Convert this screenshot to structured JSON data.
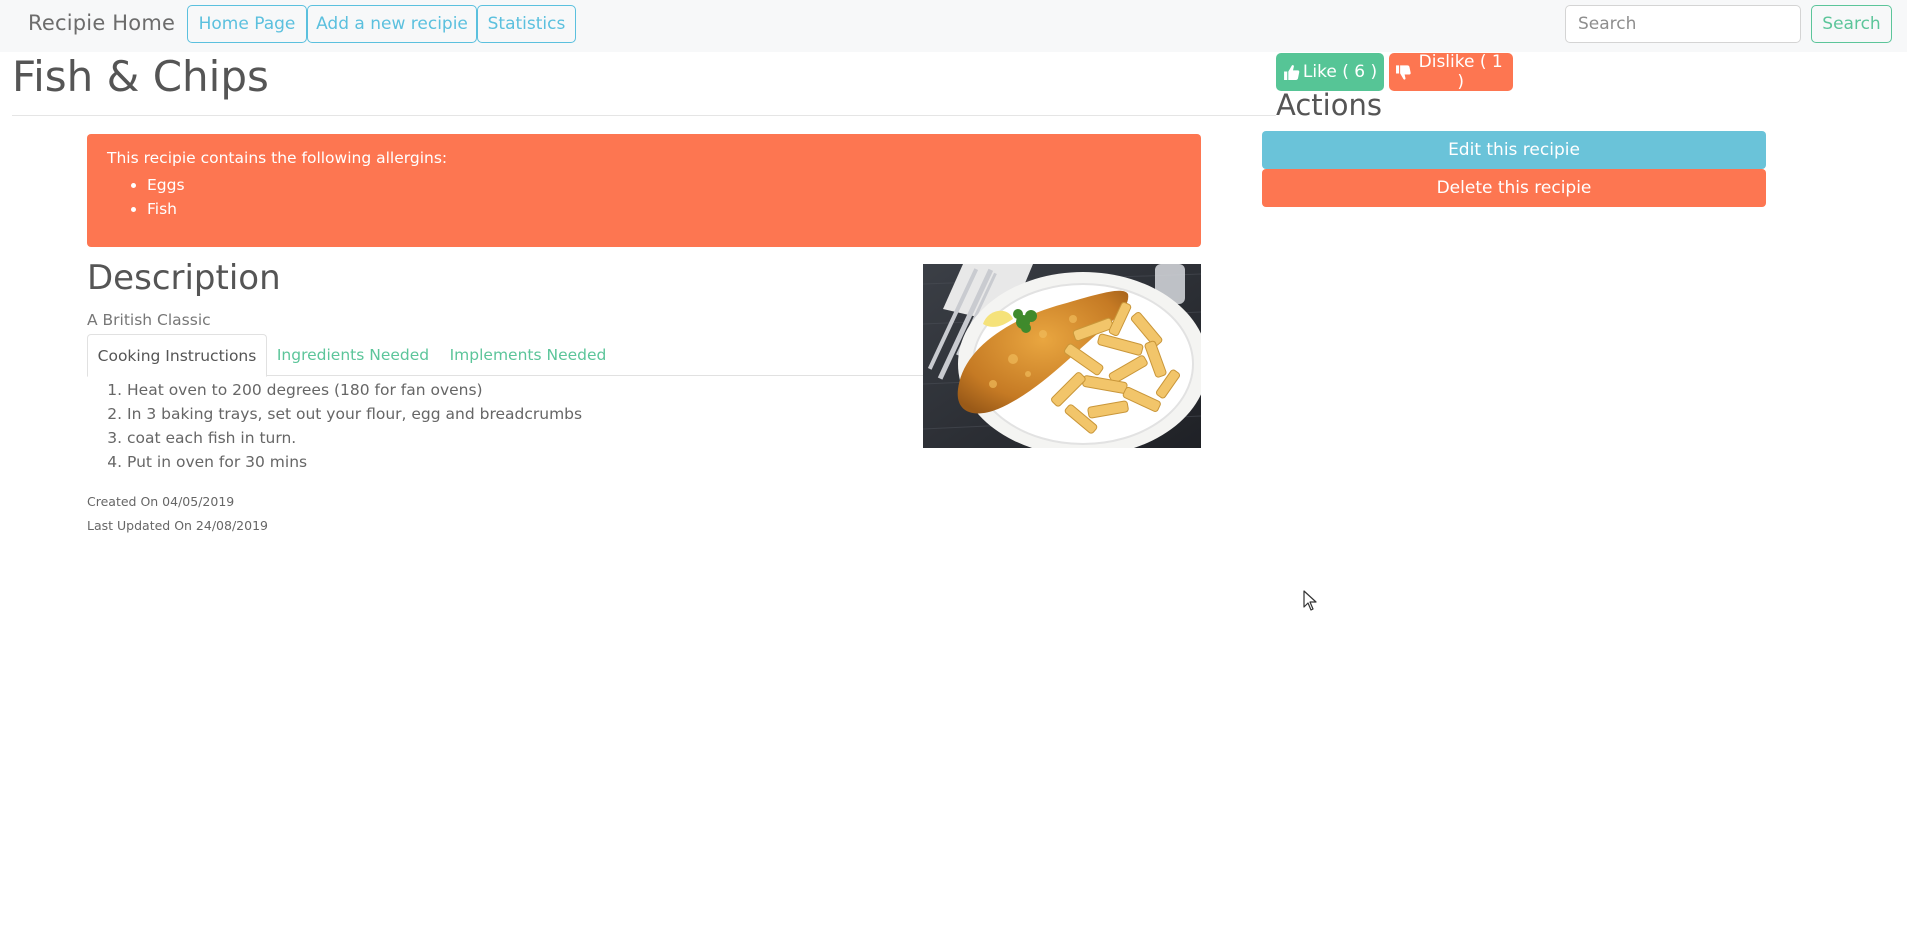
{
  "navbar": {
    "brand": "Recipie Home",
    "links": [
      {
        "label": "Home Page"
      },
      {
        "label": "Add a new recipie"
      },
      {
        "label": "Statistics"
      }
    ],
    "search": {
      "placeholder": "Search",
      "value": "",
      "button_label": "Search"
    }
  },
  "recipe": {
    "title": "Fish & Chips",
    "allergen_alert": {
      "intro": "This recipie contains the following allergins:",
      "items": [
        "Eggs",
        "Fish"
      ]
    },
    "description_heading": "Description",
    "description": "A British Classic",
    "tabs": [
      {
        "label": "Cooking Instructions",
        "active": true
      },
      {
        "label": "Ingredients Needed",
        "active": false
      },
      {
        "label": "Implements Needed",
        "active": false
      }
    ],
    "steps": [
      "Heat oven to 200 degrees (180 for fan ovens)",
      "In 3 baking trays, set out your flour, egg and breadcrumbs",
      "coat each fish in turn.",
      "Put in oven for 30 mins"
    ],
    "created": "Created On 04/05/2019",
    "updated": "Last Updated On 24/08/2019"
  },
  "votes": {
    "like_label": "Like ( 6 )",
    "dislike_label": "Dislike ( 1 )"
  },
  "actions": {
    "title": "Actions",
    "edit_label": "Edit this recipie",
    "delete_label": "Delete this recipie"
  },
  "colors": {
    "success": "#56c596",
    "info": "#6ac3d9",
    "danger": "#fd7651",
    "navbar_bg": "#f7f8f9"
  },
  "icons": {
    "like": "thumbs-up-icon",
    "dislike": "thumbs-down-icon",
    "cursor": "mouse-pointer-icon"
  }
}
